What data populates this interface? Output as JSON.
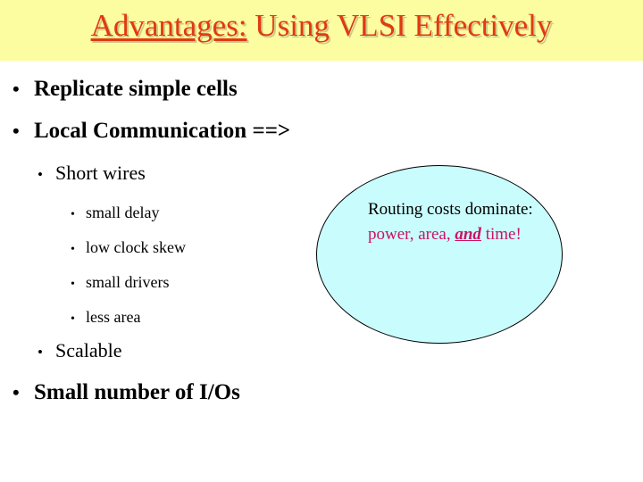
{
  "slide": {
    "title": {
      "underlined_part": "Advantages:",
      "rest": " Using VLSI Effectively",
      "color": "#e03a10",
      "banner_color": "#fcfca0"
    },
    "background_color": "#ffffff"
  },
  "outline": {
    "bullet_glyph": "•",
    "items": [
      {
        "level": 1,
        "text": "Replicate simple cells"
      },
      {
        "level": 1,
        "text": "Local Communication ==>"
      },
      {
        "level": 2,
        "text": "Short wires"
      },
      {
        "level": 3,
        "text": "small delay"
      },
      {
        "level": 3,
        "text": "low clock skew"
      },
      {
        "level": 3,
        "text": "small drivers"
      },
      {
        "level": 3,
        "text": "less area"
      },
      {
        "level": 2,
        "text": "Scalable"
      },
      {
        "level": 1,
        "text": "Small number of I/Os"
      }
    ]
  },
  "callout": {
    "shape": "ellipse",
    "fill_color": "#c9fcfc",
    "border_color": "#000000",
    "accent_color": "#cc1166",
    "text_runs": [
      {
        "text": "Routing costs dominate: ",
        "style": "plain"
      },
      {
        "text": "power, area, ",
        "style": "accent"
      },
      {
        "text": "and",
        "style": "accent-emphasis"
      },
      {
        "text": " time!",
        "style": "accent"
      }
    ],
    "plain_part": "Routing costs dominate: ",
    "accent_part_1": "power, area, ",
    "accent_emphasis": "and",
    "accent_part_2": " time!"
  }
}
